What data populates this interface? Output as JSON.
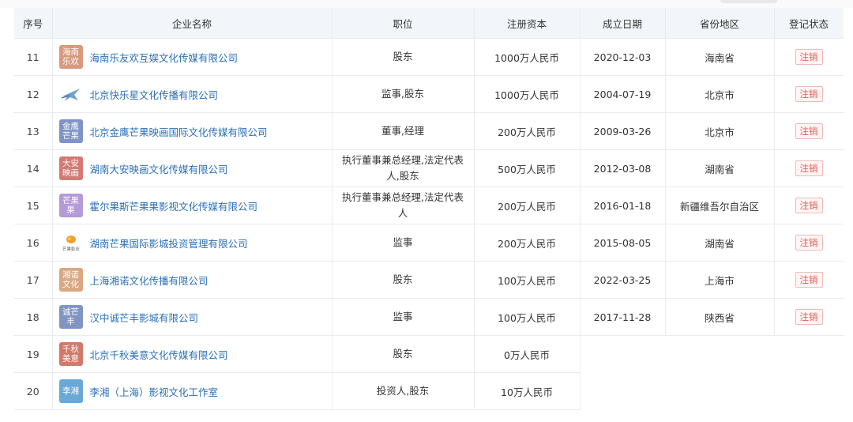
{
  "table": {
    "headers": [
      "序号",
      "企业名称",
      "职位",
      "注册资本",
      "成立日期",
      "省份地区",
      "登记状态"
    ],
    "rows": [
      {
        "no": "11",
        "logo_text": "海南\n乐欢",
        "logo_color": "#d79a7e",
        "name": "海南乐友欢互娱文化传媒有限公司",
        "position": "股东",
        "capital": "1000万人民币",
        "date": "2020-12-03",
        "region": "海南省",
        "status": "注销"
      },
      {
        "no": "12",
        "logo_icon": "star-logo-icon",
        "name": "北京快乐星文化传播有限公司",
        "position": "监事,股东",
        "capital": "1000万人民币",
        "date": "2004-07-19",
        "region": "北京市",
        "status": "注销"
      },
      {
        "no": "13",
        "logo_text": "金鹰\n芒果",
        "logo_color": "#7f93c6",
        "name": "北京金鹰芒果映画国际文化传媒有限公司",
        "position": "董事,经理",
        "capital": "200万人民币",
        "date": "2009-03-26",
        "region": "北京市",
        "status": "注销"
      },
      {
        "no": "14",
        "logo_text": "大安\n映画",
        "logo_color": "#d27a73",
        "name": "湖南大安映画文化传媒有限公司",
        "position": "执行董事兼总经理,法定代表人,股东",
        "capital": "500万人民币",
        "date": "2012-03-08",
        "region": "湖南省",
        "status": "注销"
      },
      {
        "no": "15",
        "logo_text": "芒果果",
        "logo_color": "#b59ad8",
        "name": "霍尔果斯芒果果影视文化传媒有限公司",
        "position": "执行董事兼总经理,法定代表人",
        "capital": "200万人民币",
        "date": "2016-01-18",
        "region": "新疆维吾尔自治区",
        "status": "注销"
      },
      {
        "no": "16",
        "logo_icon": "mango-logo-icon",
        "logo_caption": "芒果影业",
        "name": "湖南芒果国际影城投资管理有限公司",
        "position": "监事",
        "capital": "200万人民币",
        "date": "2015-08-05",
        "region": "湖南省",
        "status": "注销"
      },
      {
        "no": "17",
        "logo_text": "湘诺\n文化",
        "logo_color": "#d9a883",
        "name": "上海湘诺文化传播有限公司",
        "position": "股东",
        "capital": "100万人民币",
        "date": "2022-03-25",
        "region": "上海市",
        "status": "注销"
      },
      {
        "no": "18",
        "logo_text": "诚芒丰",
        "logo_color": "#8095c2",
        "name": "汉中诚芒丰影城有限公司",
        "position": "监事",
        "capital": "100万人民币",
        "date": "2017-11-28",
        "region": "陕西省",
        "status": "注销"
      },
      {
        "no": "19",
        "logo_text": "千秋\n美意",
        "logo_color": "#d1796a",
        "name": "北京千秋美意文化传媒有限公司",
        "position": "股东",
        "capital": "0万人民币",
        "date": "",
        "region": "",
        "status": ""
      },
      {
        "no": "20",
        "logo_text": "李湘",
        "logo_color": "#6aa8d8",
        "name": "李湘（上海）影视文化工作室",
        "position": "投资人,股东",
        "capital": "10万人民币",
        "date": "",
        "region": "",
        "status": ""
      }
    ]
  },
  "colors": {
    "link": "#2a6fb7",
    "status_text": "#e5574f",
    "header_bg": "#f2f6fa"
  }
}
